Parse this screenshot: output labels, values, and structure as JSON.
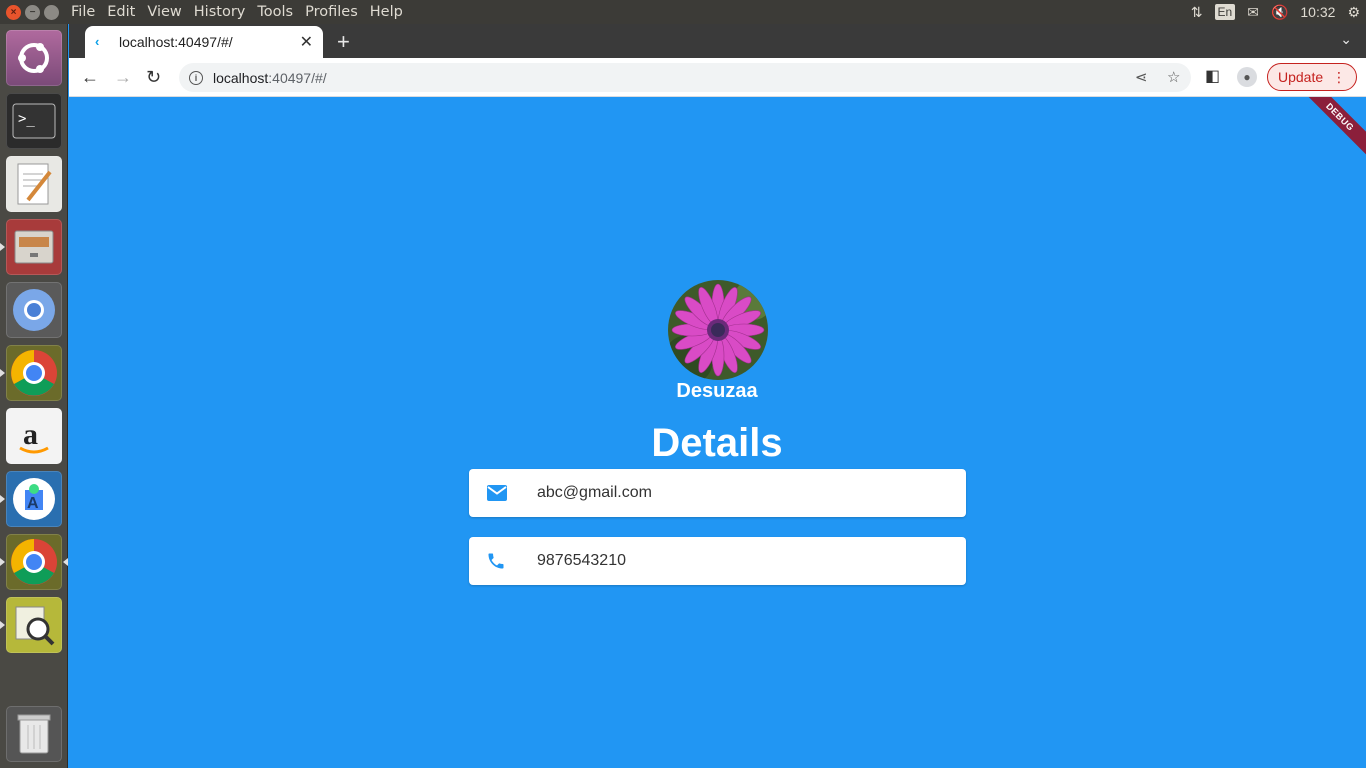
{
  "menubar": {
    "items": [
      "File",
      "Edit",
      "View",
      "History",
      "Tools",
      "Profiles",
      "Help"
    ],
    "tray": {
      "lang": "En",
      "time": "10:32"
    }
  },
  "launcher": {
    "items": [
      "ubuntu-dash",
      "terminal",
      "text-editor",
      "file-manager",
      "chromium",
      "chrome",
      "amazon",
      "android-studio",
      "chrome",
      "system-monitor",
      "trash"
    ]
  },
  "browser": {
    "tab_title": "localhost:40497/#/",
    "url_host": "localhost",
    "url_rest": ":40497/#/",
    "update_label": "Update"
  },
  "app": {
    "debug_banner": "DEBUG",
    "username": "Desuzaa",
    "heading": "Details",
    "email": "abc@gmail.com",
    "phone": "9876543210",
    "accent_color": "#2196F3",
    "icon_color": "#2196F3"
  }
}
